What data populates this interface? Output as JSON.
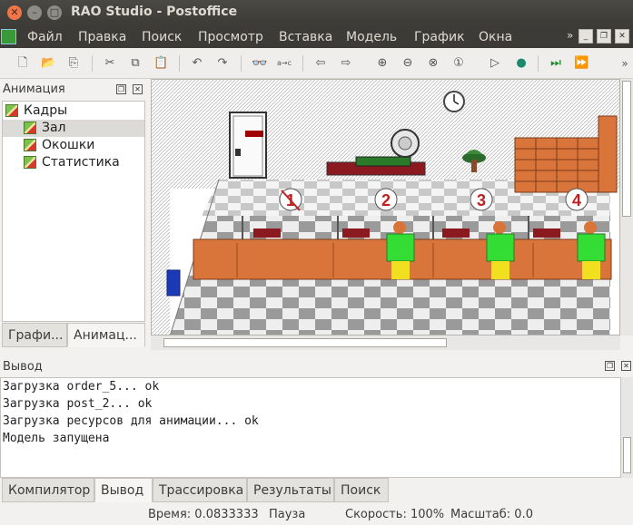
{
  "window": {
    "title": "RAO Studio - Postoffice"
  },
  "menu": {
    "items": [
      "Файл",
      "Правка",
      "Поиск",
      "Просмотр",
      "Вставка",
      "Модель",
      "График",
      "Окна"
    ]
  },
  "animation_panel": {
    "title": "Анимация",
    "tree": [
      {
        "label": "Кадры",
        "level": 0,
        "selected": false
      },
      {
        "label": "Зал",
        "level": 1,
        "selected": true
      },
      {
        "label": "Окошки",
        "level": 1,
        "selected": false
      },
      {
        "label": "Статистика",
        "level": 1,
        "selected": false
      }
    ],
    "tabs": [
      "Графи...",
      "Анимац..."
    ],
    "active_tab": 1
  },
  "scene": {
    "windows": [
      "1",
      "2",
      "3",
      "4"
    ],
    "closed_window": "1"
  },
  "output_panel": {
    "title": "Вывод",
    "lines": [
      "Загрузка order_5... ok",
      "Загрузка post_2... ok",
      "Загрузка ресурсов для анимации... ok",
      "Модель запущена"
    ]
  },
  "bottom_tabs": [
    "Компилятор",
    "Вывод",
    "Трассировка",
    "Результаты",
    "Поиск"
  ],
  "bottom_active_tab": 1,
  "status": {
    "time": "Время: 0.0833333",
    "state": "Пауза",
    "speed": "Скорость: 100%",
    "scale": "Масштаб: 0.0"
  },
  "colors": {
    "accent_orange": "#f0764a",
    "counter": "#d9743a",
    "customer_shirt": "#33dd33",
    "customer_pants": "#f0e020"
  }
}
